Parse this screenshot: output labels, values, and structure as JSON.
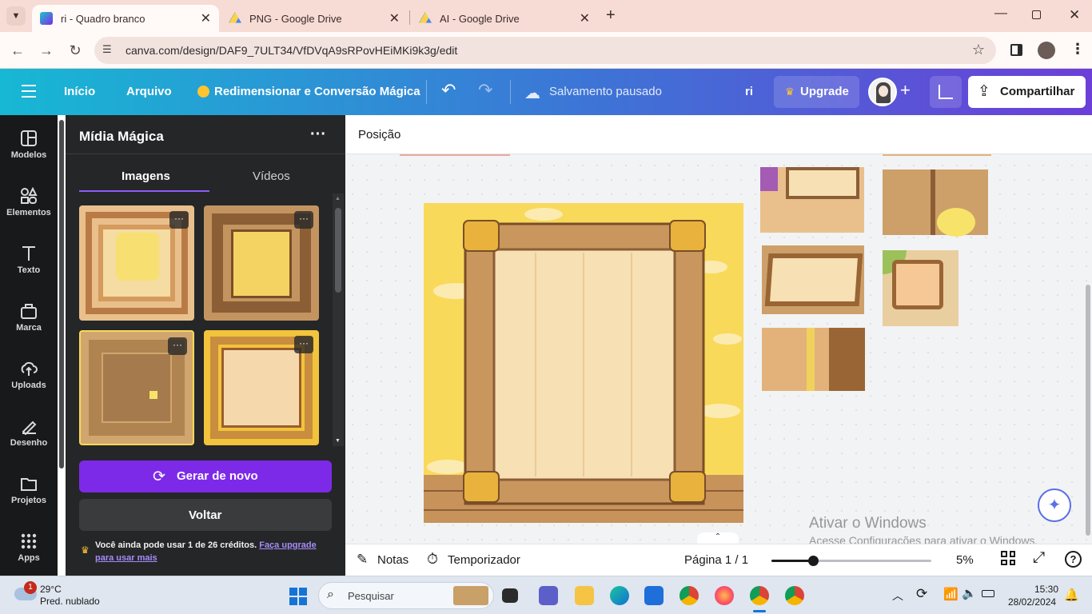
{
  "browser": {
    "tabs": [
      {
        "title": "ri - Quadro branco",
        "active": true
      },
      {
        "title": "PNG - Google Drive",
        "active": false
      },
      {
        "title": "AI - Google Drive",
        "active": false
      }
    ],
    "url": "canva.com/design/DAF9_7ULT34/VfDVqA9sRPovHEiMKi9k3g/edit"
  },
  "canva": {
    "menu": {
      "home": "Início",
      "file": "Arquivo",
      "resize": "Redimensionar e Conversão Mágica"
    },
    "save_status": "Salvamento pausado",
    "design_title": "ri",
    "upgrade": "Upgrade",
    "share": "Compartilhar",
    "rail": [
      {
        "label": "Modelos",
        "icon": "templates-icon"
      },
      {
        "label": "Elementos",
        "icon": "elements-icon"
      },
      {
        "label": "Texto",
        "icon": "text-icon"
      },
      {
        "label": "Marca",
        "icon": "brand-icon"
      },
      {
        "label": "Uploads",
        "icon": "uploads-icon"
      },
      {
        "label": "Desenho",
        "icon": "draw-icon"
      },
      {
        "label": "Projetos",
        "icon": "projects-icon"
      },
      {
        "label": "Apps",
        "icon": "apps-icon"
      }
    ],
    "panel": {
      "title": "Mídia Mágica",
      "tabs": [
        "Imagens",
        "Vídeos"
      ],
      "regenerate": "Gerar de novo",
      "back": "Voltar",
      "credits_text": "Você ainda pode usar 1 de 26 créditos.",
      "upgrade_link": "Faça upgrade para usar mais"
    },
    "position_label": "Posição",
    "bottom": {
      "notes": "Notas",
      "timer": "Temporizador",
      "page": "Página 1 / 1",
      "zoom": "5%"
    },
    "watermark": {
      "title": "Ativar o Windows",
      "subtitle": "Acesse Configurações para ativar o Windows."
    }
  },
  "taskbar": {
    "weather_temp": "29°C",
    "weather_desc": "Pred. nublado",
    "weather_badge": "1",
    "search_placeholder": "Pesquisar",
    "time": "15:30",
    "date": "28/02/2024"
  },
  "colors": {
    "accent_purple": "#7d2ae8",
    "header_start": "#17b8d4",
    "header_end": "#6b3fd8",
    "frame_yellow": "#f8d95a",
    "wood": "#c9a06a"
  }
}
